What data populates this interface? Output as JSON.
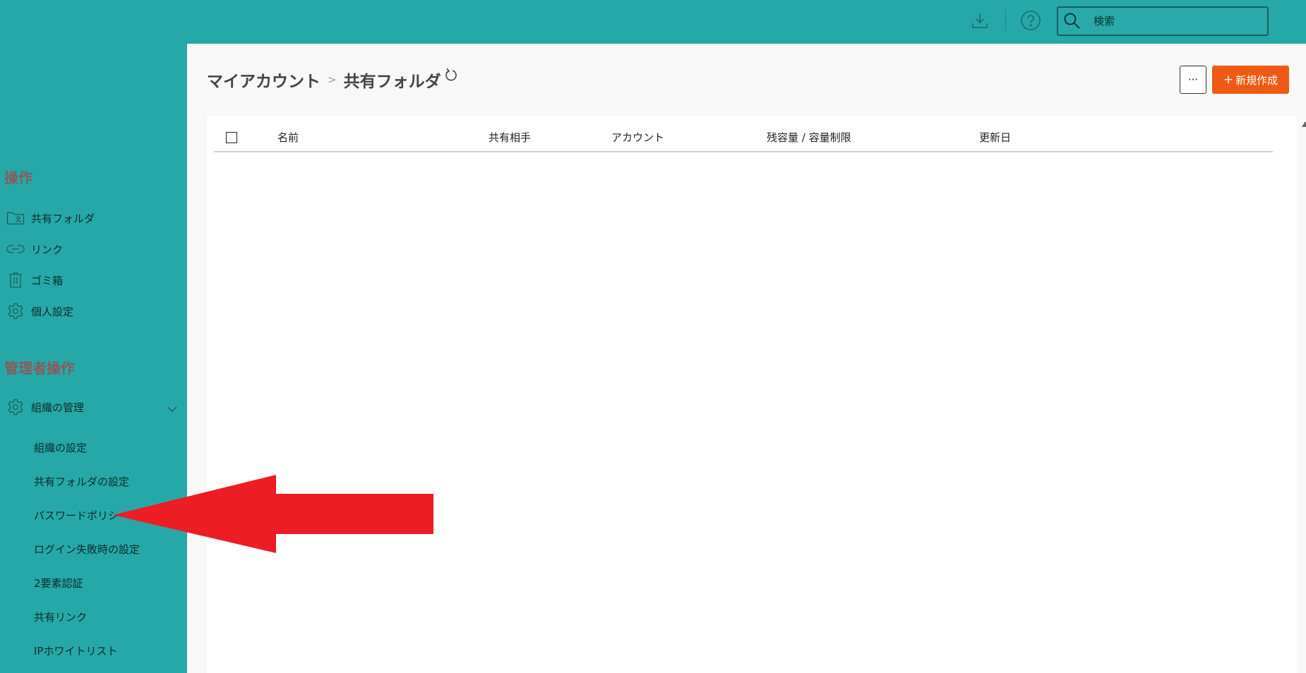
{
  "topbar": {
    "search_placeholder": "検索",
    "icons": [
      "download-icon",
      "help-icon",
      "search-icon"
    ]
  },
  "sidebar": {
    "section_operations": "操作",
    "operations": [
      {
        "label": "共有フォルダ",
        "icon": "shared-folder-icon"
      },
      {
        "label": "リンク",
        "icon": "link-icon"
      },
      {
        "label": "ゴミ箱",
        "icon": "trash-icon"
      },
      {
        "label": "個人設定",
        "icon": "gear-icon"
      }
    ],
    "section_admin": "管理者操作",
    "admin_group": {
      "label": "組織の管理",
      "icon": "gear-icon",
      "expanded": true
    },
    "admin_items": [
      "組織の設定",
      "共有フォルダの設定",
      "パスワードポリシー",
      "ログイン失敗時の設定",
      "2要素認証",
      "共有リンク",
      "IPホワイトリスト"
    ]
  },
  "main": {
    "breadcrumb": [
      "マイアカウント",
      "共有フォルダ"
    ],
    "more_label": "···",
    "new_button_label": "新規作成",
    "new_button_plus": "+",
    "columns": [
      "名前",
      "共有相手",
      "アカウント",
      "残容量 / 容量制限",
      "更新日"
    ]
  },
  "colors": {
    "accent": "#27a8a8",
    "primary_button": "#ee5a14",
    "section_title": "#8a5a5a",
    "annotation_arrow": "#ee1c25"
  }
}
